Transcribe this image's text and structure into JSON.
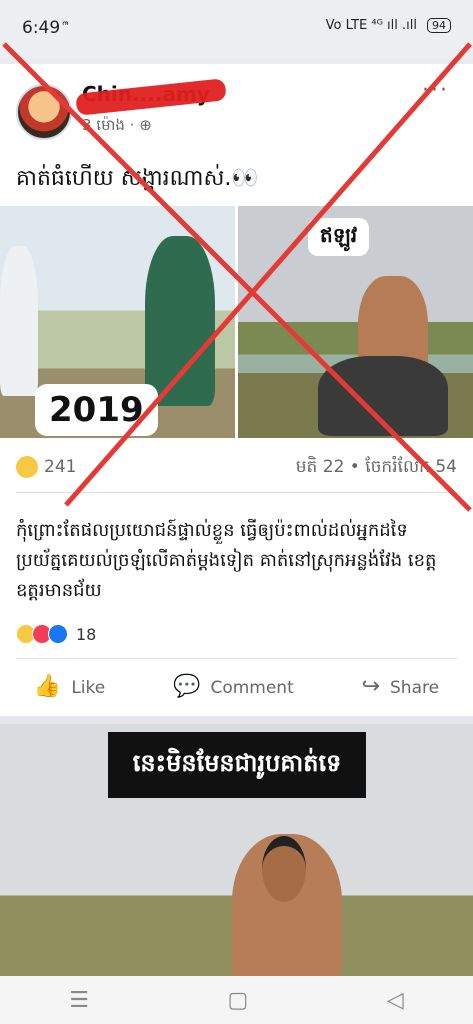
{
  "status": {
    "time": "6:49",
    "glyph": "ᩨ",
    "signal": "Vo LTE  ⁴ᴳ ıll .ıll",
    "battery": "94"
  },
  "post": {
    "author": "Chin....amy",
    "time": "3 ម៉ោង ·",
    "privacy_icon": "globe-icon",
    "more": "···",
    "caption": "គាត់ធំហើយ សង្ហារណាស់.👀",
    "photos": [
      {
        "tag": "2019"
      },
      {
        "tag": "ឥឡូវ"
      }
    ],
    "reactions_count": "241",
    "stats": "មតិ 22 • ចែករំលែក 54"
  },
  "comment": {
    "text": "កុំព្រោះតែផលប្រយោជន៍ផ្ទាល់ខ្លួន ធ្វើឲ្យប៉ះពាល់ដល់អ្នកដទៃ ប្រយ័ត្នគេយល់ច្រឡំលើគាត់ម្តងទៀត គាត់នៅស្រុកអន្លង់វែង ខេត្តឧត្តរមានជ័យ",
    "reactions_count": "18"
  },
  "actions": {
    "like": "Like",
    "comment": "Comment",
    "share": "Share"
  },
  "second": {
    "banner": "នេះមិនមែនជារូបគាត់ទេ"
  },
  "navbar": {
    "menu": "☰",
    "home": "▢",
    "back": "◁"
  }
}
